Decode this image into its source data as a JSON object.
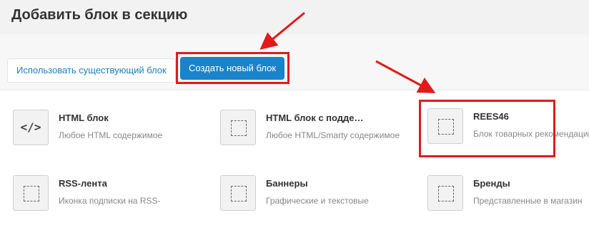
{
  "dialog": {
    "title": "Добавить блок в секцию"
  },
  "toolbar": {
    "use_existing_label": "Использовать существующий блок",
    "create_new_label": "Создать новый блок"
  },
  "blocks": [
    {
      "name": "HTML блок",
      "desc": "Любое HTML содержимое",
      "icon": "code-icon",
      "icon_text": "</>"
    },
    {
      "name": "HTML блок с подде…",
      "desc": "Любое HTML/Smarty содержимое",
      "icon": "dotted-square-icon"
    },
    {
      "name": "REES46",
      "desc": "Блок товарных рекомендаций",
      "icon": "dotted-square-icon"
    },
    {
      "name": "RSS-лента",
      "desc": "Иконка подписки на RSS-",
      "icon": "dotted-square-icon"
    },
    {
      "name": "Баннеры",
      "desc": "Графические и текстовые",
      "icon": "dotted-square-icon"
    },
    {
      "name": "Бренды",
      "desc": "Представленные в магазин",
      "icon": "dotted-square-icon"
    }
  ],
  "annotation": {
    "color": "#e01b1b"
  },
  "colors": {
    "primary_button": "#1a83c9",
    "link": "#1b7fc2"
  }
}
